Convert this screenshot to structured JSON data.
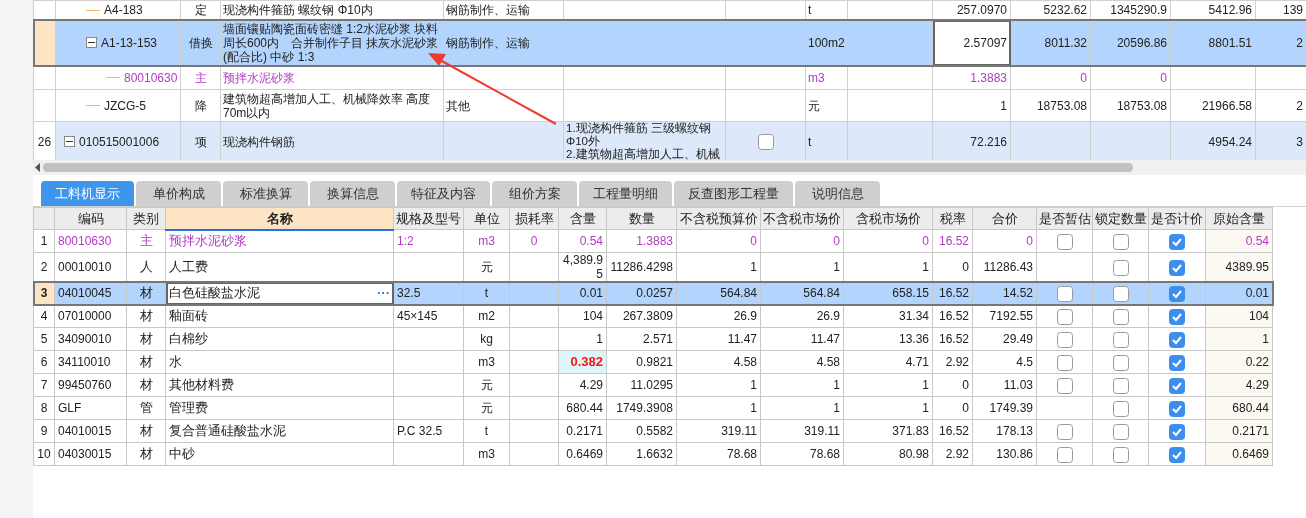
{
  "upper_grid": {
    "rows": [
      {
        "code": "A4-183",
        "category": "定",
        "name": "现浇构件箍筋 螺纹钢 Φ10内",
        "column_5": "钢筋制作、运输",
        "unit": "t",
        "column_10": "257.0970",
        "column_11": "5232.62",
        "column_12": "1345290.9",
        "column_13": "5412.96",
        "column_14": "139",
        "selected": false,
        "kind": "quota"
      },
      {
        "code": "A1-13-153",
        "category": "借换",
        "name": "墙面镶贴陶瓷面砖密缝 1:2水泥砂浆 块料周长600内　合并制作子目 抹灰水泥砂浆(配合比) 中砂 1:3",
        "column_5": "钢筋制作、运输",
        "unit": "100m2",
        "column_10": "2.57097",
        "column_11": "8011.32",
        "column_12": "20596.86",
        "column_13": "8801.51",
        "column_14": "2",
        "selected": true,
        "expanded": true,
        "kind": "quota",
        "children": [
          {
            "code": "80010630",
            "category": "主",
            "name": "预拌水泥砂浆",
            "unit": "m3",
            "column_10": "1.3883",
            "column_11": "0",
            "column_12": "0",
            "selected": false,
            "kind": "main_material"
          }
        ]
      },
      {
        "code": "JZCG-5",
        "category": "降",
        "name": "建筑物超高增加人工、机械降效率 高度70m以内",
        "column_5": "其他",
        "unit": "元",
        "column_10": "1",
        "column_11": "18753.08",
        "column_12": "18753.08",
        "column_13": "21966.58",
        "column_14": "2",
        "selected": false,
        "kind": "quota"
      },
      {
        "row_number": "26",
        "code": "010515001006",
        "category": "项",
        "name": "现浇构件钢筋",
        "column_6": "1.现浇构件箍筋 三级螺纹钢Φ10外\n2.建筑物超高增加人工、机械",
        "checked": false,
        "unit": "t",
        "column_10": "72.216",
        "column_13": "4954.24",
        "column_14": "3",
        "selected": false,
        "expanded": true,
        "kind": "item"
      }
    ]
  },
  "tabs": [
    {
      "label": "工料机显示",
      "selected": true
    },
    {
      "label": "单价构成",
      "selected": false
    },
    {
      "label": "标准换算",
      "selected": false
    },
    {
      "label": "换算信息",
      "selected": false
    },
    {
      "label": "特征及内容",
      "selected": false
    },
    {
      "label": "组价方案",
      "selected": false
    },
    {
      "label": "工程量明细",
      "selected": false
    },
    {
      "label": "反查图形工程量",
      "selected": false
    },
    {
      "label": "说明信息",
      "selected": false
    }
  ],
  "resource_table": {
    "columns": [
      {
        "label": "编码",
        "selected": false
      },
      {
        "label": "类别",
        "selected": false
      },
      {
        "label": "名称",
        "selected": true
      },
      {
        "label": "规格及型号",
        "selected": false
      },
      {
        "label": "单位",
        "selected": false
      },
      {
        "label": "损耗率",
        "selected": false
      },
      {
        "label": "含量",
        "selected": false
      },
      {
        "label": "数量",
        "selected": false
      },
      {
        "label": "不含税预算价",
        "selected": false
      },
      {
        "label": "不含税市场价",
        "selected": false
      },
      {
        "label": "含税市场价",
        "selected": false
      },
      {
        "label": "税率",
        "selected": false
      },
      {
        "label": "合价",
        "selected": false
      },
      {
        "label": "是否暂估",
        "selected": false
      },
      {
        "label": "锁定数量",
        "selected": false
      },
      {
        "label": "是否计价",
        "selected": false
      },
      {
        "label": "原始含量",
        "selected": false
      }
    ],
    "rows": [
      {
        "row_number": "1",
        "code": "80010630",
        "category": "主",
        "name": "预拌水泥砂浆",
        "spec": "1:2",
        "unit": "m3",
        "loss_rate": "0",
        "content": "0.54",
        "content_modified": false,
        "quantity": "1.3883",
        "budget_price": "0",
        "market_price": "0",
        "market_price_tax": "0",
        "tax_rate": "16.52",
        "total": "0",
        "provisional": false,
        "locked": false,
        "priced": true,
        "original_content": "0.54",
        "kind": "main_material",
        "selected": false
      },
      {
        "row_number": "2",
        "code": "00010010",
        "category": "人",
        "name": "人工费",
        "unit": "元",
        "content": "4,389.95",
        "content_modified": false,
        "quantity": "11286.4298",
        "budget_price": "1",
        "market_price": "1",
        "market_price_tax": "1",
        "tax_rate": "0",
        "total": "11286.43",
        "locked": false,
        "priced": true,
        "original_content": "4389.95",
        "kind": "normal",
        "selected": false
      },
      {
        "row_number": "3",
        "code": "04010045",
        "category": "材",
        "name": "白色硅酸盐水泥",
        "more_button": "···",
        "spec": "32.5",
        "unit": "t",
        "content": "0.01",
        "content_modified": false,
        "quantity": "0.0257",
        "budget_price": "564.84",
        "market_price": "564.84",
        "market_price_tax": "658.15",
        "tax_rate": "16.52",
        "total": "14.52",
        "provisional": false,
        "locked": false,
        "priced": true,
        "original_content": "0.01",
        "kind": "normal",
        "selected": true
      },
      {
        "row_number": "4",
        "code": "07010000",
        "category": "材",
        "name": "釉面砖",
        "spec": "45×145",
        "unit": "m2",
        "content": "104",
        "content_modified": false,
        "quantity": "267.3809",
        "budget_price": "26.9",
        "market_price": "26.9",
        "market_price_tax": "31.34",
        "tax_rate": "16.52",
        "total": "7192.55",
        "provisional": false,
        "locked": false,
        "priced": true,
        "original_content": "104",
        "kind": "normal",
        "selected": false
      },
      {
        "row_number": "5",
        "code": "34090010",
        "category": "材",
        "name": "白棉纱",
        "unit": "kg",
        "content": "1",
        "content_modified": false,
        "quantity": "2.571",
        "budget_price": "11.47",
        "market_price": "11.47",
        "market_price_tax": "13.36",
        "tax_rate": "16.52",
        "total": "29.49",
        "provisional": false,
        "locked": false,
        "priced": true,
        "original_content": "1",
        "kind": "normal",
        "selected": false
      },
      {
        "row_number": "6",
        "code": "34110010",
        "category": "材",
        "name": "水",
        "unit": "m3",
        "content": "0.382",
        "content_modified": true,
        "quantity": "0.9821",
        "budget_price": "4.58",
        "market_price": "4.58",
        "market_price_tax": "4.71",
        "tax_rate": "2.92",
        "total": "4.5",
        "provisional": false,
        "locked": false,
        "priced": true,
        "original_content": "0.22",
        "kind": "normal",
        "selected": false
      },
      {
        "row_number": "7",
        "code": "99450760",
        "category": "材",
        "name": "其他材料费",
        "unit": "元",
        "content": "4.29",
        "content_modified": false,
        "quantity": "11.0295",
        "budget_price": "1",
        "market_price": "1",
        "market_price_tax": "1",
        "tax_rate": "0",
        "total": "11.03",
        "provisional": false,
        "locked": false,
        "priced": true,
        "original_content": "4.29",
        "kind": "normal",
        "selected": false
      },
      {
        "row_number": "8",
        "code": "GLF",
        "category": "管",
        "name": "管理费",
        "unit": "元",
        "content": "680.44",
        "content_modified": false,
        "quantity": "1749.3908",
        "budget_price": "1",
        "market_price": "1",
        "market_price_tax": "1",
        "tax_rate": "0",
        "total": "1749.39",
        "locked": false,
        "priced": true,
        "original_content": "680.44",
        "kind": "normal",
        "selected": false
      },
      {
        "row_number": "9",
        "code": "04010015",
        "category": "材",
        "name": "复合普通硅酸盐水泥",
        "spec": "P.C 32.5",
        "unit": "t",
        "content": "0.2171",
        "content_modified": false,
        "quantity": "0.5582",
        "budget_price": "319.11",
        "market_price": "319.11",
        "market_price_tax": "371.83",
        "tax_rate": "16.52",
        "total": "178.13",
        "provisional": false,
        "locked": false,
        "priced": true,
        "original_content": "0.2171",
        "kind": "normal",
        "selected": false
      },
      {
        "row_number": "10",
        "code": "04030015",
        "category": "材",
        "name": "中砂",
        "unit": "m3",
        "content": "0.6469",
        "content_modified": false,
        "quantity": "1.6632",
        "budget_price": "78.68",
        "market_price": "78.68",
        "market_price_tax": "80.98",
        "tax_rate": "2.92",
        "total": "130.86",
        "provisional": false,
        "locked": false,
        "priced": true,
        "original_content": "0.6469",
        "kind": "normal",
        "selected": false
      }
    ]
  }
}
